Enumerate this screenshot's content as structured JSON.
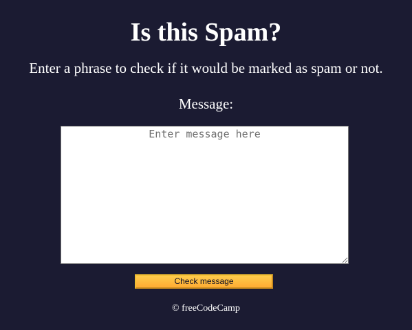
{
  "header": {
    "title": "Is this Spam?",
    "description": "Enter a phrase to check if it would be marked as spam or not."
  },
  "form": {
    "label": "Message:",
    "message_placeholder": "Enter message here",
    "message_value": "",
    "submit_label": "Check message"
  },
  "footer": {
    "text": "© freeCodeCamp"
  },
  "colors": {
    "background": "#1b1b32",
    "text": "#ffffff",
    "button": "#feac32"
  }
}
